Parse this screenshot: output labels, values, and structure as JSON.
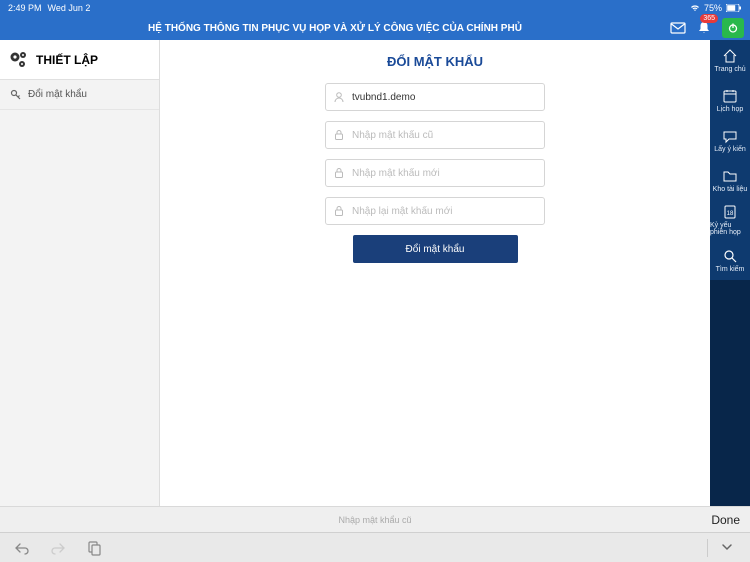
{
  "status": {
    "time": "2:49 PM",
    "date": "Wed Jun 2",
    "battery": "75%"
  },
  "header": {
    "title": "HỆ THỐNG THÔNG TIN PHỤC VỤ HỌP VÀ XỬ LÝ CÔNG VIỆC CỦA CHÍNH PHỦ",
    "badge": "365"
  },
  "sidebar": {
    "title": "THIẾT LẬP",
    "items": [
      {
        "label": "Đổi mật khẩu"
      }
    ]
  },
  "main": {
    "title": "ĐỔI MẬT KHẨU",
    "username": "tvubnd1.demo",
    "placeholders": {
      "old": "Nhập mật khẩu cũ",
      "new": "Nhập mật khẩu mới",
      "confirm": "Nhập lại mật khẩu mới"
    },
    "submit_label": "Đổi mật khẩu"
  },
  "rail": {
    "items": [
      {
        "label": "Trang chủ"
      },
      {
        "label": "Lịch họp"
      },
      {
        "label": "Lấy ý kiến"
      },
      {
        "label": "Kho tài liệu"
      },
      {
        "label": "Kỷ yếu phiên họp"
      },
      {
        "label": "Tìm kiếm"
      }
    ]
  },
  "hint": {
    "text": "Nhập mật khẩu cũ",
    "done": "Done"
  },
  "colors": {
    "primary": "#2a6fc9",
    "dark": "#1a3f7a",
    "rail": "#0e3a6f"
  }
}
